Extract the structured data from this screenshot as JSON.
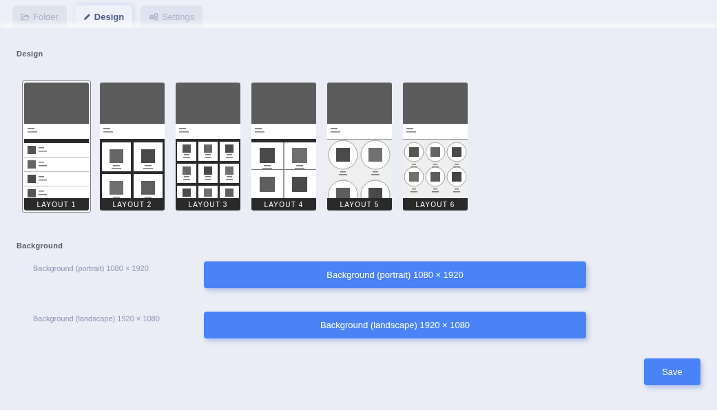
{
  "tabs": [
    {
      "label": "Folder",
      "kind": "folder",
      "selected": false
    },
    {
      "label": "Design",
      "kind": "pencil",
      "selected": true
    },
    {
      "label": "Settings",
      "kind": "gears",
      "selected": false
    }
  ],
  "design": {
    "title": "Design",
    "layouts": [
      {
        "label": "LAYOUT 1",
        "kind": "list",
        "selected": true
      },
      {
        "label": "LAYOUT 2",
        "kind": "grid2",
        "selected": false
      },
      {
        "label": "LAYOUT 3",
        "kind": "grid3",
        "selected": false
      },
      {
        "label": "LAYOUT 4",
        "kind": "tiles2",
        "selected": false
      },
      {
        "label": "LAYOUT 5",
        "kind": "circles2",
        "selected": false
      },
      {
        "label": "LAYOUT 6",
        "kind": "circles3",
        "selected": false
      }
    ]
  },
  "background": {
    "title": "Background",
    "rows": [
      {
        "label": "Background (portrait) 1080 × 1920",
        "button": "Background (portrait) 1080 × 1920"
      },
      {
        "label": "Background (landscape) 1920 × 1080",
        "button": "Background (landscape) 1920 × 1080"
      }
    ]
  },
  "save_button": "Save"
}
